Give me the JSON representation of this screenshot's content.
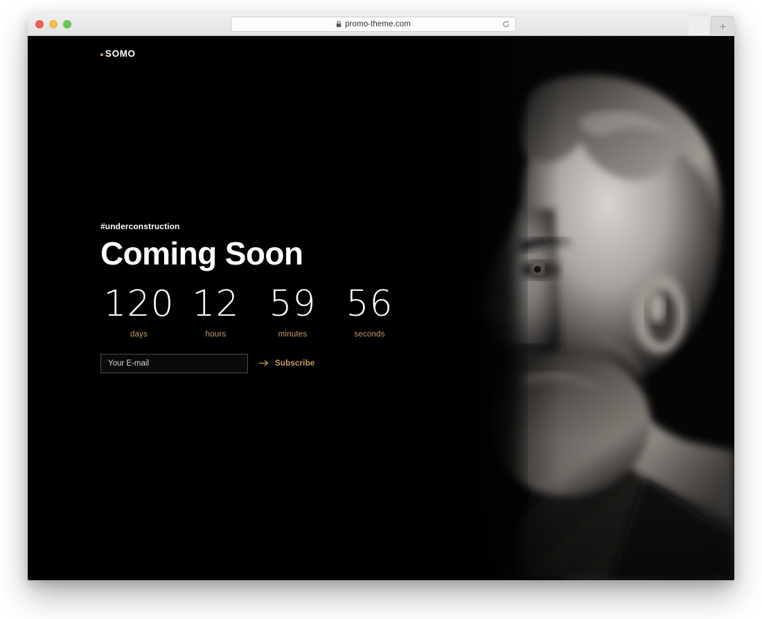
{
  "browser": {
    "url": "promo-theme.com",
    "lock_icon": "lock-icon",
    "reload_icon": "reload-icon",
    "newtab_label": "+",
    "traffic_lights": [
      "close",
      "minimize",
      "maximize"
    ],
    "colors": {
      "close": "#f15d55",
      "minimize": "#f2bf4e",
      "maximize": "#62c955"
    }
  },
  "page": {
    "logo": {
      "dot_icon": "bullet-dot-icon",
      "text": "SOMO",
      "dot_color": "#c9a063"
    },
    "hero": {
      "tagline": "#underconstruction",
      "headline": "Coming Soon"
    },
    "countdown": {
      "units": [
        {
          "value": "120",
          "label": "days"
        },
        {
          "value": "12",
          "label": "hours"
        },
        {
          "value": "59",
          "label": "minutes"
        },
        {
          "value": "56",
          "label": "seconds"
        }
      ],
      "label_color": "#c9a063"
    },
    "subscribe": {
      "placeholder": "Your E-mail",
      "value": "",
      "arrow_icon": "arrow-right-icon",
      "button_label": "Subscribe",
      "accent_color": "#c9a063"
    },
    "background_color": "#000000",
    "photo_alt": "black-and-white profile portrait of a bearded man"
  }
}
